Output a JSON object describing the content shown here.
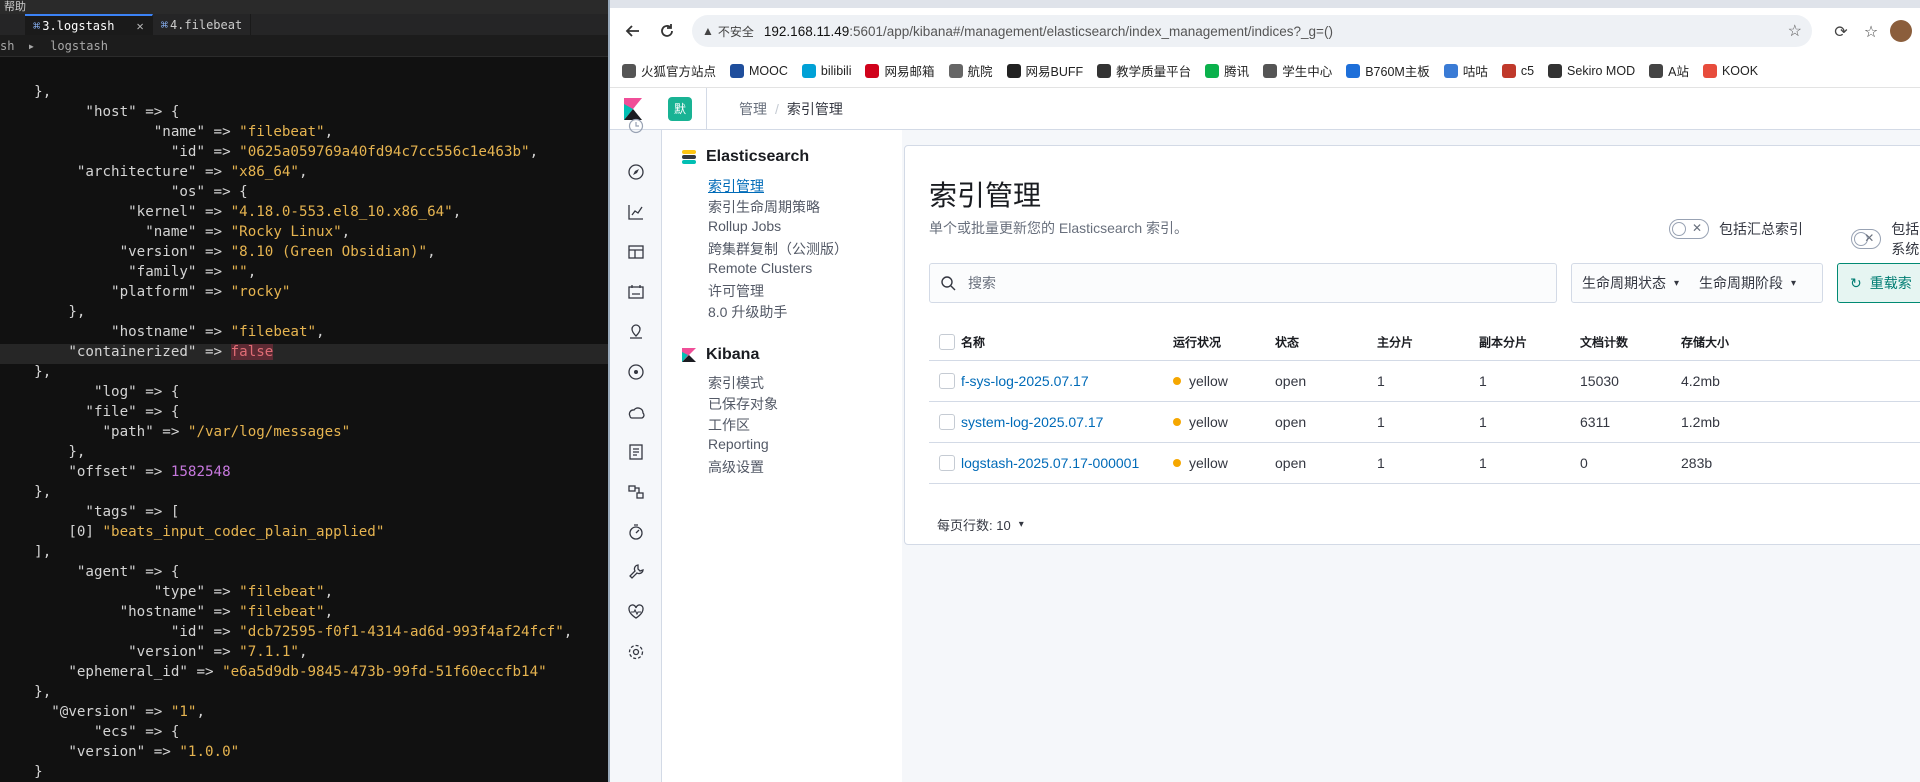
{
  "terminal": {
    "menu": "帮助",
    "tabs": [
      {
        "cmd": "⌘",
        "label": "3.logstash",
        "close": "✕"
      },
      {
        "cmd": "⌘",
        "label": "4.filebeat"
      }
    ],
    "path_prefix": "sh",
    "path_sep": "▸",
    "path": "logstash",
    "lines": [
      [
        [
          "p",
          "    },"
        ]
      ],
      [
        [
          "k",
          "          \"host\" => "
        ],
        [
          "p",
          "{"
        ]
      ],
      [
        [
          "k",
          "                  \"name\" => "
        ],
        [
          "s",
          "\"filebeat\""
        ],
        [
          "p",
          ","
        ]
      ],
      [
        [
          "k",
          "                    \"id\" => "
        ],
        [
          "s",
          "\"0625a059769a40fd94c7cc556c1e463b\""
        ],
        [
          "p",
          ","
        ]
      ],
      [
        [
          "k",
          "         \"architecture\" => "
        ],
        [
          "s",
          "\"x86_64\""
        ],
        [
          "p",
          ","
        ]
      ],
      [
        [
          "k",
          "                    \"os\" => "
        ],
        [
          "p",
          "{"
        ]
      ],
      [
        [
          "k",
          "               \"kernel\" => "
        ],
        [
          "s",
          "\"4.18.0-553.el8_10.x86_64\""
        ],
        [
          "p",
          ","
        ]
      ],
      [
        [
          "k",
          "                 \"name\" => "
        ],
        [
          "s",
          "\"Rocky Linux\""
        ],
        [
          "p",
          ","
        ]
      ],
      [
        [
          "k",
          "              \"version\" => "
        ],
        [
          "s",
          "\"8.10 (Green Obsidian)\""
        ],
        [
          "p",
          ","
        ]
      ],
      [
        [
          "k",
          "               \"family\" => "
        ],
        [
          "s",
          "\"\""
        ],
        [
          "p",
          ","
        ]
      ],
      [
        [
          "k",
          "             \"platform\" => "
        ],
        [
          "s",
          "\"rocky\""
        ]
      ],
      [
        [
          "p",
          "        },"
        ]
      ],
      [
        [
          "k",
          "             \"hostname\" => "
        ],
        [
          "s",
          "\"filebeat\""
        ],
        [
          "p",
          ","
        ]
      ],
      [
        [
          "k",
          "        \"containerized\" => "
        ],
        [
          "b",
          "false"
        ]
      ],
      [
        [
          "p",
          "    },"
        ]
      ],
      [
        [
          "k",
          "           \"log\" => "
        ],
        [
          "p",
          "{"
        ]
      ],
      [
        [
          "k",
          "          \"file\" => "
        ],
        [
          "p",
          "{"
        ]
      ],
      [
        [
          "k",
          "            \"path\" => "
        ],
        [
          "s",
          "\"/var/log/messages\""
        ]
      ],
      [
        [
          "p",
          "        },"
        ]
      ],
      [
        [
          "k",
          "        \"offset\" => "
        ],
        [
          "n",
          "1582548"
        ]
      ],
      [
        [
          "p",
          "    },"
        ]
      ],
      [
        [
          "k",
          "          \"tags\" => "
        ],
        [
          "p",
          "["
        ]
      ],
      [
        [
          "k",
          "        [0] "
        ],
        [
          "s",
          "\"beats_input_codec_plain_applied\""
        ]
      ],
      [
        [
          "p",
          "    ],"
        ]
      ],
      [
        [
          "k",
          "         \"agent\" => "
        ],
        [
          "p",
          "{"
        ]
      ],
      [
        [
          "k",
          "                  \"type\" => "
        ],
        [
          "s",
          "\"filebeat\""
        ],
        [
          "p",
          ","
        ]
      ],
      [
        [
          "k",
          "              \"hostname\" => "
        ],
        [
          "s",
          "\"filebeat\""
        ],
        [
          "p",
          ","
        ]
      ],
      [
        [
          "k",
          "                    \"id\" => "
        ],
        [
          "s",
          "\"dcb72595-f0f1-4314-ad6d-993f4af24fcf\""
        ],
        [
          "p",
          ","
        ]
      ],
      [
        [
          "k",
          "               \"version\" => "
        ],
        [
          "s",
          "\"7.1.1\""
        ],
        [
          "p",
          ","
        ]
      ],
      [
        [
          "k",
          "        \"ephemeral_id\" => "
        ],
        [
          "s",
          "\"e6a5d9db-9845-473b-99fd-51f60eccfb14\""
        ]
      ],
      [
        [
          "p",
          "    },"
        ]
      ],
      [
        [
          "k",
          "      \"@version\" => "
        ],
        [
          "s",
          "\"1\""
        ],
        [
          "p",
          ","
        ]
      ],
      [
        [
          "k",
          "           \"ecs\" => "
        ],
        [
          "p",
          "{"
        ]
      ],
      [
        [
          "k",
          "        \"version\" => "
        ],
        [
          "s",
          "\"1.0.0\""
        ]
      ],
      [
        [
          "p",
          "    }"
        ]
      ]
    ]
  },
  "browser": {
    "url": {
      "insecure_label": "不安全",
      "host": "192.168.11.49",
      "rest": ":5601/app/kibana#/management/elasticsearch/index_management/indices?_g=()"
    },
    "bookmarks": [
      {
        "label": "火狐官方站点",
        "color": "#555"
      },
      {
        "label": "MOOC",
        "color": "#1f4e9c"
      },
      {
        "label": "bilibili",
        "color": "#00a1d6"
      },
      {
        "label": "网易邮箱",
        "color": "#d0021b"
      },
      {
        "label": "航院",
        "color": "#666"
      },
      {
        "label": "网易BUFF",
        "color": "#222"
      },
      {
        "label": "教学质量平台",
        "color": "#333"
      },
      {
        "label": "腾讯",
        "color": "#0bb14c"
      },
      {
        "label": "学生中心",
        "color": "#555"
      },
      {
        "label": "B760M主板",
        "color": "#1e6fd9"
      },
      {
        "label": "咕咕",
        "color": "#3a7bd5"
      },
      {
        "label": "c5",
        "color": "#c0392b"
      },
      {
        "label": "Sekiro MOD",
        "color": "#333"
      },
      {
        "label": "A站",
        "color": "#444"
      },
      {
        "label": "KOOK",
        "color": "#e74c3c"
      }
    ]
  },
  "kibana": {
    "space_letter": "默",
    "breadcrumb": [
      "管理",
      "索引管理"
    ],
    "sections": [
      {
        "title": "Elasticsearch",
        "items": [
          "索引管理",
          "索引生命周期策略",
          "Rollup Jobs",
          "跨集群复制（公测版）",
          "Remote Clusters",
          "许可管理",
          "8.0 升级助手"
        ]
      },
      {
        "title": "Kibana",
        "items": [
          "索引模式",
          "已保存对象",
          "工作区",
          "Reporting",
          "高级设置"
        ]
      }
    ],
    "page_title": "索引管理",
    "page_desc": "单个或批量更新您的 Elasticsearch 索引。",
    "toggle_rollup": "包括汇总索引",
    "toggle_system": "包括系统",
    "search_placeholder": "搜索",
    "filter_lifecycle_status": "生命周期状态",
    "filter_lifecycle_phase": "生命周期阶段",
    "reload_button": "重载索",
    "columns": [
      "名称",
      "运行状况",
      "状态",
      "主分片",
      "副本分片",
      "文档计数",
      "存储大小"
    ],
    "rows": [
      {
        "name": "f-sys-log-2025.07.17",
        "health": "yellow",
        "status": "open",
        "primary": "1",
        "replica": "1",
        "docs": "15030",
        "size": "4.2mb"
      },
      {
        "name": "system-log-2025.07.17",
        "health": "yellow",
        "status": "open",
        "primary": "1",
        "replica": "1",
        "docs": "6311",
        "size": "1.2mb"
      },
      {
        "name": "logstash-2025.07.17-000001",
        "health": "yellow",
        "status": "open",
        "primary": "1",
        "replica": "1",
        "docs": "0",
        "size": "283b"
      }
    ],
    "health_color": "#f5a700",
    "rows_per_page": "每页行数: 10"
  }
}
